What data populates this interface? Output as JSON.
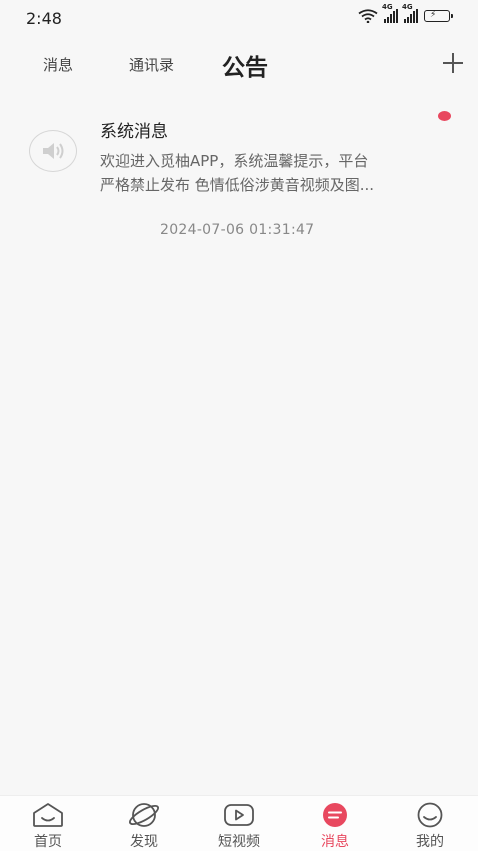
{
  "status_bar": {
    "time": "2:48",
    "network_label": "4G"
  },
  "header": {
    "tabs": [
      {
        "label": "消息"
      },
      {
        "label": "通讯录"
      },
      {
        "label": "公告"
      }
    ],
    "active_tab": "公告",
    "add_icon": "plus-icon"
  },
  "notice": {
    "icon": "speaker-icon",
    "title": "系统消息",
    "body_line1": " 欢迎进入觅柚APP，系统温馨提示，平台",
    "body_line2": "严格禁止发布 色情低俗涉黄音视频及图...",
    "time": "2024-07-06 01:31:47",
    "unread": true
  },
  "bottom_nav": {
    "items": [
      {
        "label": "首页",
        "icon": "home-icon"
      },
      {
        "label": "发现",
        "icon": "planet-icon"
      },
      {
        "label": "短视频",
        "icon": "play-icon"
      },
      {
        "label": "消息",
        "icon": "message-icon"
      },
      {
        "label": "我的",
        "icon": "smile-face-icon"
      }
    ],
    "active": "消息"
  },
  "colors": {
    "accent": "#e8485f",
    "background": "#f7f7f7",
    "text_primary": "#222222",
    "text_secondary": "#666666"
  }
}
